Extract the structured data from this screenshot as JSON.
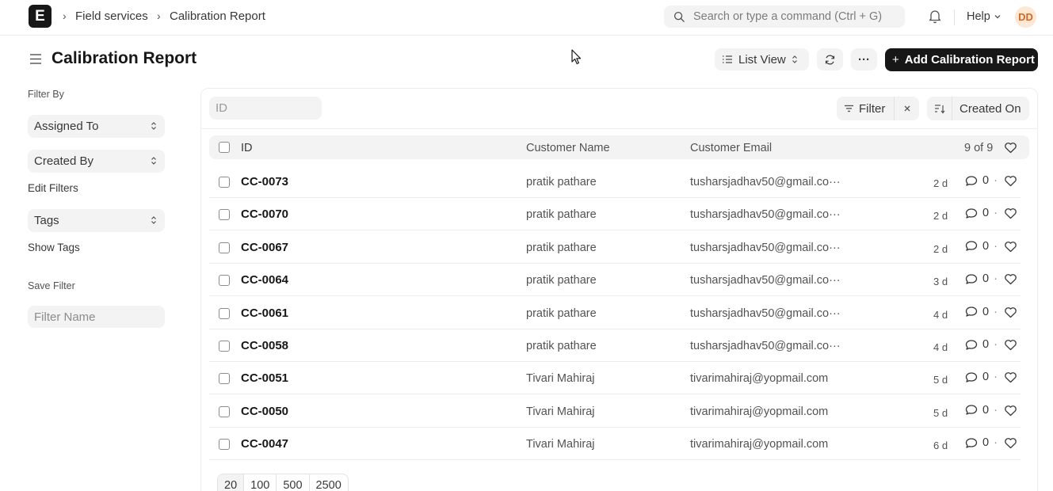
{
  "navbar": {
    "logo": "E",
    "breadcrumbs": [
      "Field services",
      "Calibration Report"
    ],
    "search_placeholder": "Search or type a command (Ctrl + G)",
    "help_label": "Help",
    "avatar_initials": "DD"
  },
  "page": {
    "title": "Calibration Report",
    "view_label": "List View",
    "more_label": "···",
    "add_label": "Add Calibration Report"
  },
  "sidebar": {
    "filter_by": "Filter By",
    "assigned_to": "Assigned To",
    "created_by": "Created By",
    "edit_filters": "Edit Filters",
    "tags": "Tags",
    "show_tags": "Show Tags",
    "save_filter": "Save Filter",
    "filter_name_placeholder": "Filter Name"
  },
  "toolbar": {
    "id_placeholder": "ID",
    "filter_label": "Filter",
    "sort_label": "Created On"
  },
  "table": {
    "columns": {
      "id": "ID",
      "customer_name": "Customer Name",
      "customer_email": "Customer Email",
      "count": "9 of 9"
    },
    "rows": [
      {
        "id": "CC-0073",
        "name": "pratik pathare",
        "email": "tusharsjadhav50@gmail.co···",
        "time": "2 d",
        "comments": "0"
      },
      {
        "id": "CC-0070",
        "name": "pratik pathare",
        "email": "tusharsjadhav50@gmail.co···",
        "time": "2 d",
        "comments": "0"
      },
      {
        "id": "CC-0067",
        "name": "pratik pathare",
        "email": "tusharsjadhav50@gmail.co···",
        "time": "2 d",
        "comments": "0"
      },
      {
        "id": "CC-0064",
        "name": "pratik pathare",
        "email": "tusharsjadhav50@gmail.co···",
        "time": "3 d",
        "comments": "0"
      },
      {
        "id": "CC-0061",
        "name": "pratik pathare",
        "email": "tusharsjadhav50@gmail.co···",
        "time": "4 d",
        "comments": "0"
      },
      {
        "id": "CC-0058",
        "name": "pratik pathare",
        "email": "tusharsjadhav50@gmail.co···",
        "time": "4 d",
        "comments": "0"
      },
      {
        "id": "CC-0051",
        "name": "Tivari Mahiraj",
        "email": "tivarimahiraj@yopmail.com",
        "time": "5 d",
        "comments": "0"
      },
      {
        "id": "CC-0050",
        "name": "Tivari Mahiraj",
        "email": "tivarimahiraj@yopmail.com",
        "time": "5 d",
        "comments": "0"
      },
      {
        "id": "CC-0047",
        "name": "Tivari Mahiraj",
        "email": "tivarimahiraj@yopmail.com",
        "time": "6 d",
        "comments": "0"
      }
    ]
  },
  "pagination": {
    "sizes": [
      "20",
      "100",
      "500",
      "2500"
    ]
  }
}
